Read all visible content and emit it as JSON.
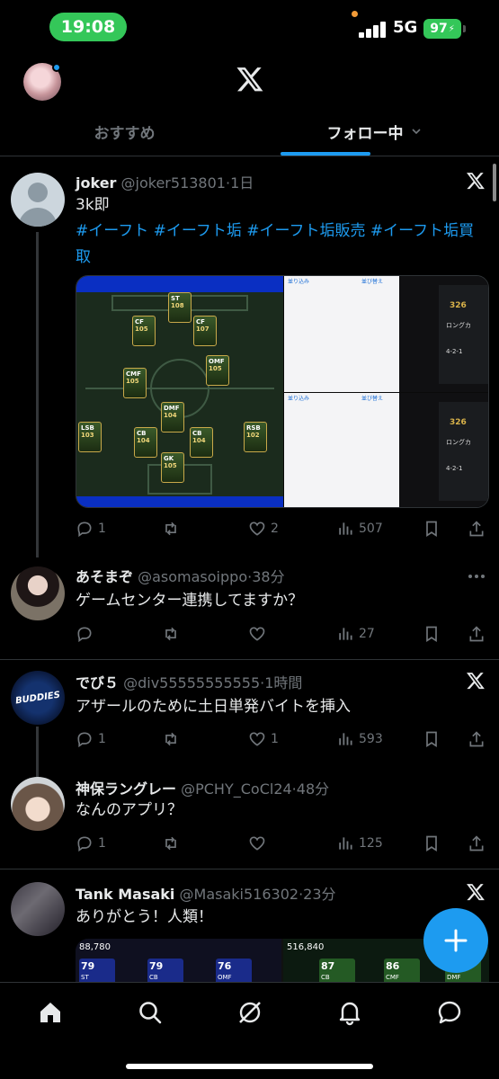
{
  "status_bar": {
    "time": "19:08",
    "network": "5G",
    "battery": "97"
  },
  "top_bar": {
    "avatar_alt": "profile",
    "logo": "x-logo-icon"
  },
  "tabs": [
    {
      "label": "おすすめ",
      "active": false
    },
    {
      "label": "フォロー中",
      "active": true
    }
  ],
  "tweets": [
    {
      "name": "joker",
      "handle": "@joker513801",
      "time": "1日",
      "text": "3k即",
      "hashtags": "#イーフト #イーフト垢 #イーフト垢販売 #イーフト垢買取",
      "replies": "1",
      "retweets": "",
      "likes": "2",
      "views": "507",
      "media": {
        "positions": [
          "ST",
          "CF",
          "CF",
          "CMF",
          "OMF",
          "DMF",
          "LSB",
          "CB",
          "CB",
          "RSB",
          "GK"
        ],
        "ratings": [
          "108",
          "105",
          "107",
          "105",
          "105",
          "104",
          "103",
          "104",
          "104",
          "102",
          "105"
        ],
        "sheet_header": [
          "並り込み",
          "並び替え"
        ],
        "side_value": "326",
        "side_text": "ロングカ",
        "formation": "4-2-1"
      }
    },
    {
      "name": "あそまぞ",
      "handle": "@asomasoippo",
      "time": "38分",
      "text": "ゲームセンター連携してますか？",
      "replies": "",
      "retweets": "",
      "likes": "",
      "views": "27"
    },
    {
      "name": "でび５",
      "handle": "@div55555555555",
      "time": "1時間",
      "text": "アザールのために土日単発バイトを挿入",
      "replies": "1",
      "retweets": "",
      "likes": "1",
      "views": "593",
      "avatar_text": "BUDDIES"
    },
    {
      "name": "神保ラングレー",
      "handle": "@PCHY_CoCl24",
      "time": "48分",
      "text": "なんのアプリ？",
      "replies": "1",
      "retweets": "",
      "likes": "",
      "views": "125"
    },
    {
      "name": "Tank Masaki",
      "handle": "@Masaki516302",
      "time": "23分",
      "text": "ありがとう！人類！",
      "media": {
        "left_value": "88,780",
        "right_value": "516,840",
        "left_cards": [
          {
            "rating": "79",
            "pos": "ST"
          },
          {
            "rating": "79",
            "pos": "CB"
          },
          {
            "rating": "76",
            "pos": "OMF"
          }
        ],
        "right_cards": [
          {
            "rating": "87",
            "pos": "CB"
          },
          {
            "rating": "86",
            "pos": "CMF"
          },
          {
            "rating": "86",
            "pos": "DMF"
          }
        ]
      }
    }
  ],
  "fab": {
    "label": "+"
  },
  "bottom_nav": [
    "home-icon",
    "search-icon",
    "grok-icon",
    "bell-icon",
    "messages-icon"
  ],
  "colors": {
    "accent": "#1d9bf0",
    "background": "#000000",
    "text": "#e7e9ea",
    "muted": "#71767b"
  }
}
